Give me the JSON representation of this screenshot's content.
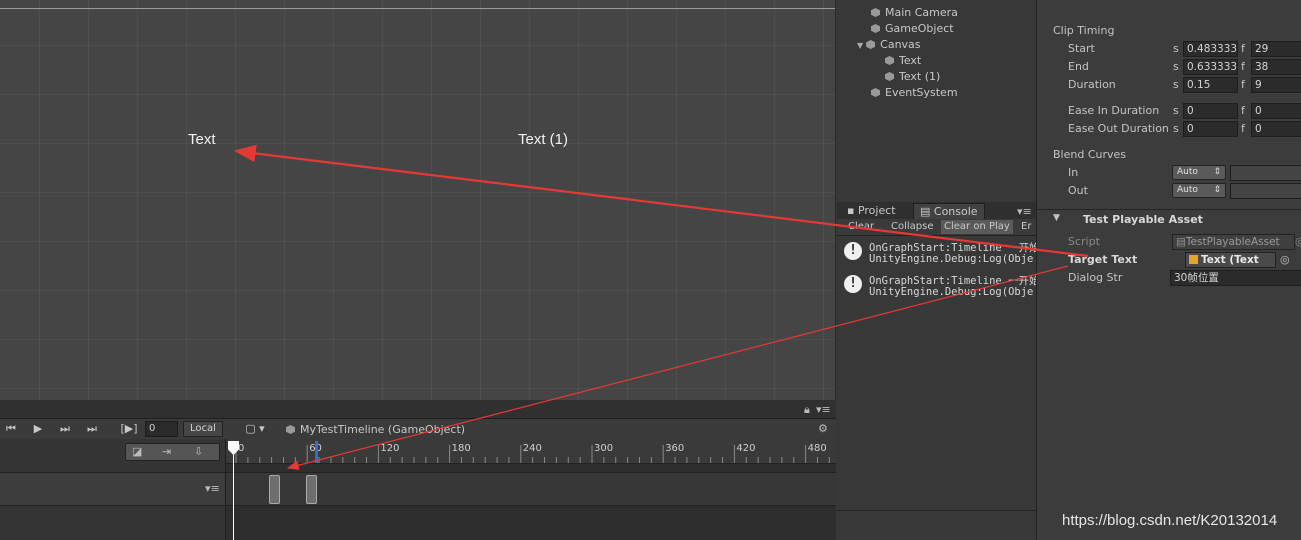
{
  "scene": {
    "text_labels": [
      "Text",
      "Text (1)"
    ]
  },
  "timeline": {
    "toolbar": {
      "frame_value": "0",
      "local_label": "Local",
      "asset_label": "MyTestTimeline (GameObject)"
    },
    "ruler_ticks": [
      "0",
      "60",
      "120",
      "180",
      "240",
      "300",
      "360",
      "420",
      "480"
    ]
  },
  "hierarchy": {
    "items": [
      "Main Camera",
      "GameObject",
      "Canvas",
      "Text",
      "Text (1)",
      "EventSystem"
    ]
  },
  "console": {
    "tabs": [
      "Project",
      "Console"
    ],
    "toolbar": [
      "Clear",
      "Collapse",
      "Clear on Play",
      "Er"
    ],
    "logs": [
      {
        "line1": "OnGraphStart:Timeline 一开始",
        "line2": "UnityEngine.Debug:Log(Obje"
      },
      {
        "line1": "OnGraphStart:Timeline 一开始",
        "line2": "UnityEngine.Debug:Log(Obje"
      }
    ]
  },
  "inspector": {
    "clip_timing": {
      "title": "Clip Timing",
      "start_label": "Start",
      "start_s": "0.483333",
      "start_f": "29",
      "end_label": "End",
      "end_s": "0.633333",
      "end_f": "38",
      "duration_label": "Duration",
      "duration_s": "0.15",
      "duration_f": "9",
      "ease_in_label": "Ease In Duration",
      "ease_in_s": "0",
      "ease_in_f": "0",
      "ease_out_label": "Ease Out Duration",
      "ease_out_s": "0",
      "ease_out_f": "0",
      "s_unit": "s",
      "f_unit": "f"
    },
    "blend_curves": {
      "title": "Blend Curves",
      "in_label": "In",
      "in_value": "Auto",
      "out_label": "Out",
      "out_value": "Auto"
    },
    "playable": {
      "title": "Test Playable Asset",
      "script_label": "Script",
      "script_value": "TestPlayableAsset",
      "target_label": "Target Text",
      "target_value": "Text (Text",
      "dialog_label": "Dialog Str",
      "dialog_value": "30帧位置"
    }
  },
  "watermark": "https://blog.csdn.net/K20132014",
  "colors": {
    "arrow": "#e53935",
    "playhead": "#ffffff",
    "end_marker": "#3c6cc6"
  }
}
